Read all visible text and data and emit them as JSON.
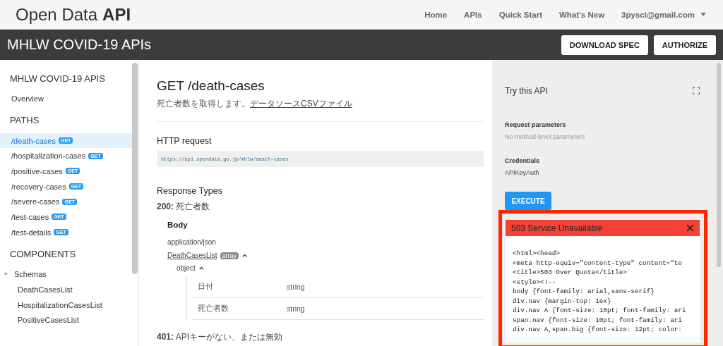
{
  "header": {
    "logo_light": "Open Data",
    "logo_bold": "API",
    "nav": [
      {
        "label": "Home"
      },
      {
        "label": "APIs"
      },
      {
        "label": "Quick Start"
      },
      {
        "label": "What's New"
      }
    ],
    "account": "3pysci@gmail.com"
  },
  "title_bar": {
    "title": "MHLW COVID-19 APIs",
    "buttons": [
      "DOWNLOAD SPEC",
      "AUTHORIZE"
    ]
  },
  "sidebar": {
    "title": "MHLW COVID-19 APIS",
    "overview": "Overview",
    "paths_heading": "PATHS",
    "paths": [
      {
        "label": "/death-cases",
        "method": "GET",
        "selected": true
      },
      {
        "label": "/hospitalization-cases",
        "method": "GET",
        "selected": false
      },
      {
        "label": "/positive-cases",
        "method": "GET",
        "selected": false
      },
      {
        "label": "/recovery-cases",
        "method": "GET",
        "selected": false
      },
      {
        "label": "/severe-cases",
        "method": "GET",
        "selected": false
      },
      {
        "label": "/test-cases",
        "method": "GET",
        "selected": false
      },
      {
        "label": "/test-details",
        "method": "GET",
        "selected": false
      }
    ],
    "components_heading": "COMPONENTS",
    "schemas": {
      "label": "Schemas",
      "expanded": true,
      "children": [
        {
          "label": "DeathCasesList"
        },
        {
          "label": "HospitalizationCasesList"
        },
        {
          "label": "PositiveCasesList"
        }
      ]
    }
  },
  "main": {
    "title": "GET /death-cases",
    "description": "死亡者数を取得します。",
    "source_link": "データソースCSVファイル",
    "request_heading": "HTTP request",
    "request_url": "https://api.opendata.go.jp/mhlw/death-cases",
    "responses_heading": "Response Types",
    "response_ok": {
      "code": "200:",
      "text": "死亡者数"
    },
    "body_heading": "Body",
    "media_type": "application/json",
    "schema_link": "DeathCasesList",
    "schema_badge": "array",
    "schema_expanded": true,
    "object_label": "object",
    "object_expanded": true,
    "fields": [
      {
        "name": "日付",
        "type": "string"
      },
      {
        "name": "死亡者数",
        "type": "string"
      }
    ],
    "response_error": {
      "code": "401:",
      "text": "APIキーがない、または無効"
    }
  },
  "try_panel": {
    "title": "Try this API",
    "params_heading": "Request parameters",
    "params_text": "No method-level parameters",
    "credentials_heading": "Credentials",
    "credentials_value": "APIKeyAuth",
    "execute": "EXECUTE",
    "result": {
      "status": "503 Service Unavailable",
      "code_lines": [
        "<html><head>",
        "<meta http-equiv=\"content-type\" content=\"te",
        "<title>503 Over Quota</title>",
        "<style><!--",
        "body {font-family: arial,sans-serif}",
        "div.nav {margin-top: 1ex}",
        "div.nav A {font-size: 10pt; font-family: ari",
        "span.nav {font-size: 10pt; font-family: ari",
        "div.nav A,span.big {font-size: 12pt; color:"
      ]
    }
  }
}
